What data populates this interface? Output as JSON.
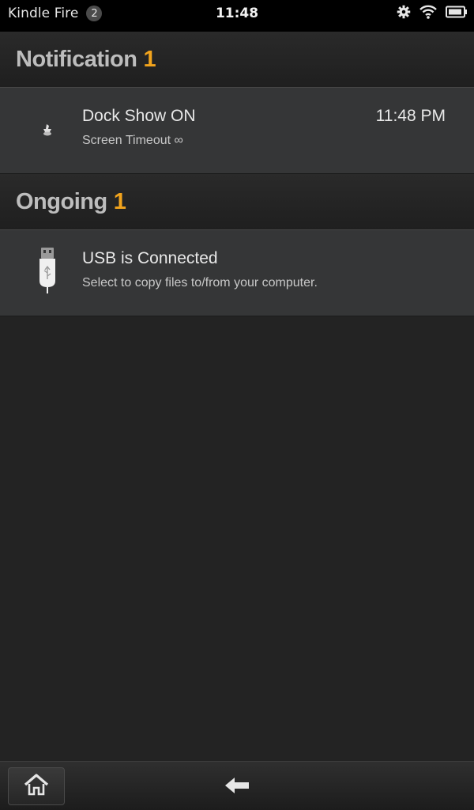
{
  "status_bar": {
    "device_name": "Kindle Fire",
    "badge_count": "2",
    "time": "11:48",
    "icons": [
      "settings-gear-icon",
      "wifi-icon",
      "battery-icon"
    ]
  },
  "sections": {
    "notification": {
      "title": "Notification",
      "count": "1"
    },
    "ongoing": {
      "title": "Ongoing",
      "count": "1"
    }
  },
  "notifications": [
    {
      "icon": "dock-show-icon",
      "title": "Dock Show ON",
      "subtitle": "Screen Timeout ∞",
      "time": "11:48 PM"
    }
  ],
  "ongoing": [
    {
      "icon": "usb-icon",
      "title": "USB is Connected",
      "subtitle": "Select to copy files to/from your computer."
    }
  ],
  "bottom_bar": {
    "icons": [
      "home-icon",
      "back-arrow-icon"
    ]
  },
  "colors": {
    "accent": "#f2a41d",
    "background": "#232323",
    "row_background": "#353637"
  }
}
